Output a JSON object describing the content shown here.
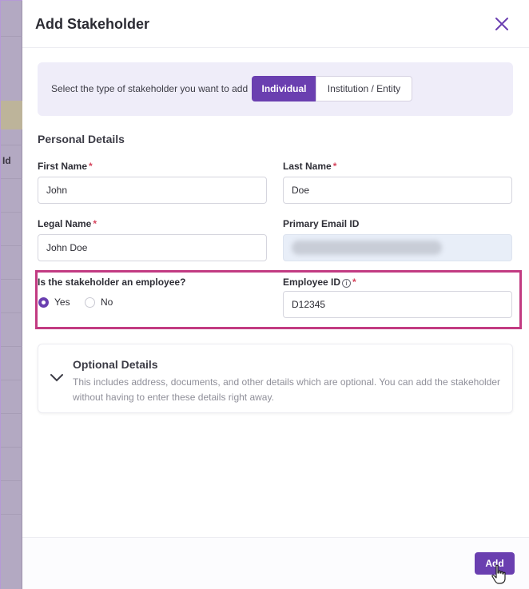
{
  "background": {
    "column_header": "Id"
  },
  "drawer": {
    "title": "Add Stakeholder",
    "close_icon": "close-icon"
  },
  "stakeholder_type": {
    "prompt": "Select the type of stakeholder you want to add",
    "options": [
      "Individual",
      "Institution / Entity"
    ],
    "selected": "Individual"
  },
  "personal_details": {
    "section_title": "Personal Details",
    "first_name": {
      "label": "First Name",
      "value": "John"
    },
    "last_name": {
      "label": "Last Name",
      "value": "Doe"
    },
    "legal_name": {
      "label": "Legal Name",
      "value": "John Doe"
    },
    "primary_email": {
      "label": "Primary Email ID",
      "value": ""
    },
    "employee_question": {
      "label": "Is the stakeholder an employee?",
      "options": [
        "Yes",
        "No"
      ],
      "selected": "Yes"
    },
    "employee_id": {
      "label": "Employee ID",
      "value": "D12345"
    }
  },
  "optional_details": {
    "title": "Optional Details",
    "description": "This includes address, documents, and other details which are optional. You can add the stakeholder without having to enter these details right away."
  },
  "footer": {
    "add_label": "Add"
  },
  "colors": {
    "accent": "#6a3fb0",
    "highlight": "#c23b82",
    "required": "#d6455d"
  }
}
